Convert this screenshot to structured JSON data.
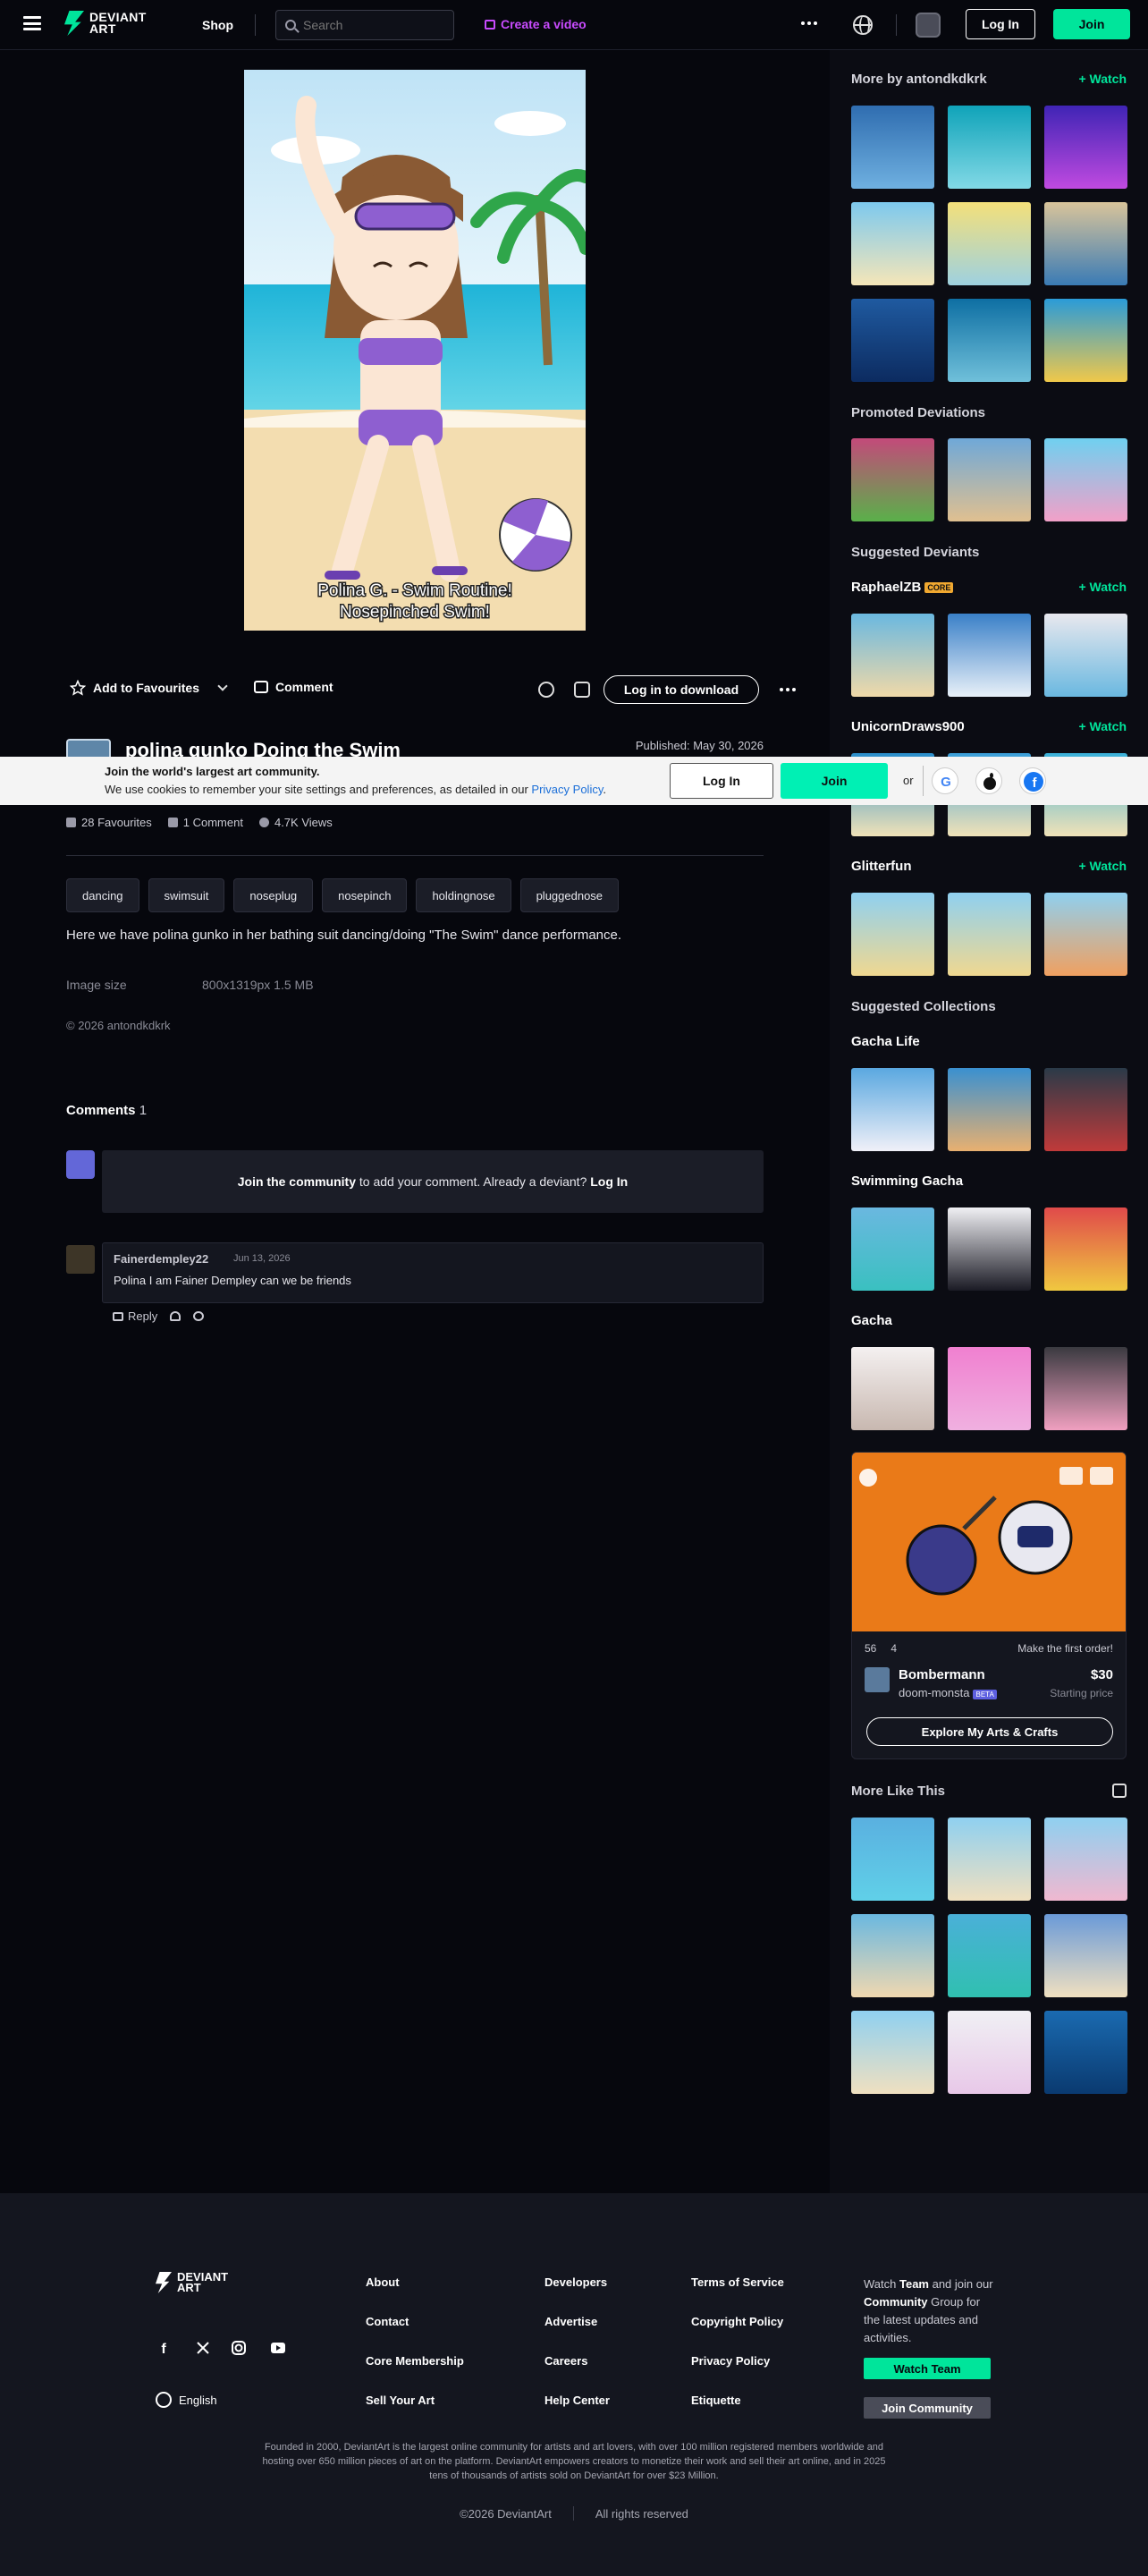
{
  "header": {
    "logo_line1": "DEVIANT",
    "logo_line2": "ART",
    "shop": "Shop",
    "search_placeholder": "Search",
    "create_video": "Create a video",
    "login": "Log In",
    "join": "Join"
  },
  "deviation": {
    "caption_line1": "Polina G. - Swim Routine!",
    "caption_line2": "Nosepinched Swim!",
    "add_favourites": "Add to Favourites",
    "comment": "Comment",
    "download": "Log in to download",
    "title": "polina gunko Doing the Swim",
    "published": "Published: May 30, 2026",
    "favourites": "28 Favourites",
    "comments_count": "1 Comment",
    "views": "4.7K Views",
    "tags": [
      "dancing",
      "swimsuit",
      "noseplug",
      "nosepinch",
      "holdingnose",
      "pluggednose"
    ],
    "description": "Here we have polina gunko in her bathing suit dancing/doing \"The Swim\" dance performance.",
    "image_size_label": "Image size",
    "image_size_value": "800x1319px 1.5 MB",
    "copyright": "© 2026 antondkdkrk"
  },
  "cookie": {
    "title": "Join the world's largest art community.",
    "text": "We use cookies to remember your site settings and preferences, as detailed in our",
    "link": "Privacy Policy",
    "period": ".",
    "login": "Log In",
    "join": "Join",
    "or": "or"
  },
  "comments": {
    "heading": "Comments",
    "count": "1",
    "join_community": "Join the community",
    "join_rest": " to add your comment. Already a deviant? ",
    "login": "Log In",
    "items": [
      {
        "user": "Fainerdempley22",
        "date": "Jun 13, 2026",
        "text": "Polina I am Fainer Dempley can we be friends",
        "reply": "Reply"
      }
    ]
  },
  "sidebar": {
    "more_by": "More by antondkdkrk",
    "watch": "+ Watch",
    "promoted": "Promoted Deviations",
    "suggested_deviants": "Suggested Deviants",
    "deviant1": "RaphaelZB",
    "core_badge": "CORE",
    "deviant2": "UnicornDraws900",
    "deviant3": "Glitterfun",
    "suggested_collections": "Suggested Collections",
    "collection1": "Gacha Life",
    "collection2": "Swimming Gacha",
    "collection3": "Gacha",
    "more_like_this": "More Like This"
  },
  "product": {
    "favs": "56",
    "comments": "4",
    "first_order": "Make the first order!",
    "name": "Bombermann",
    "user": "doom-monsta",
    "badge": "BETA",
    "price": "$30",
    "starting": "Starting price",
    "button": "Explore My Arts & Crafts"
  },
  "footer": {
    "logo_line1": "DEVIANT",
    "logo_line2": "ART",
    "language": "English",
    "col1": [
      "About",
      "Contact",
      "Core Membership",
      "Sell Your Art"
    ],
    "col2": [
      "Developers",
      "Advertise",
      "Careers",
      "Help Center"
    ],
    "col3": [
      "Terms of Service",
      "Copyright Policy",
      "Privacy Policy",
      "Etiquette"
    ],
    "watch_pre": "Watch ",
    "watch_team": "Team",
    "watch_mid": " and join our ",
    "watch_community": "Community",
    "watch_post": " Group for the latest updates and activities.",
    "watch_button": "Watch Team",
    "join_button": "Join Community",
    "about": "Founded in 2000, DeviantArt is the largest online community for artists and art lovers, with over 100 million registered members worldwide and hosting over 650 million pieces of art on the platform. DeviantArt empowers creators to monetize their work and sell their art online, and in 2025 tens of thousands of artists sold on DeviantArt for over $23 Million.",
    "copyright": "©2026 DeviantArt",
    "rights": "All rights reserved"
  }
}
